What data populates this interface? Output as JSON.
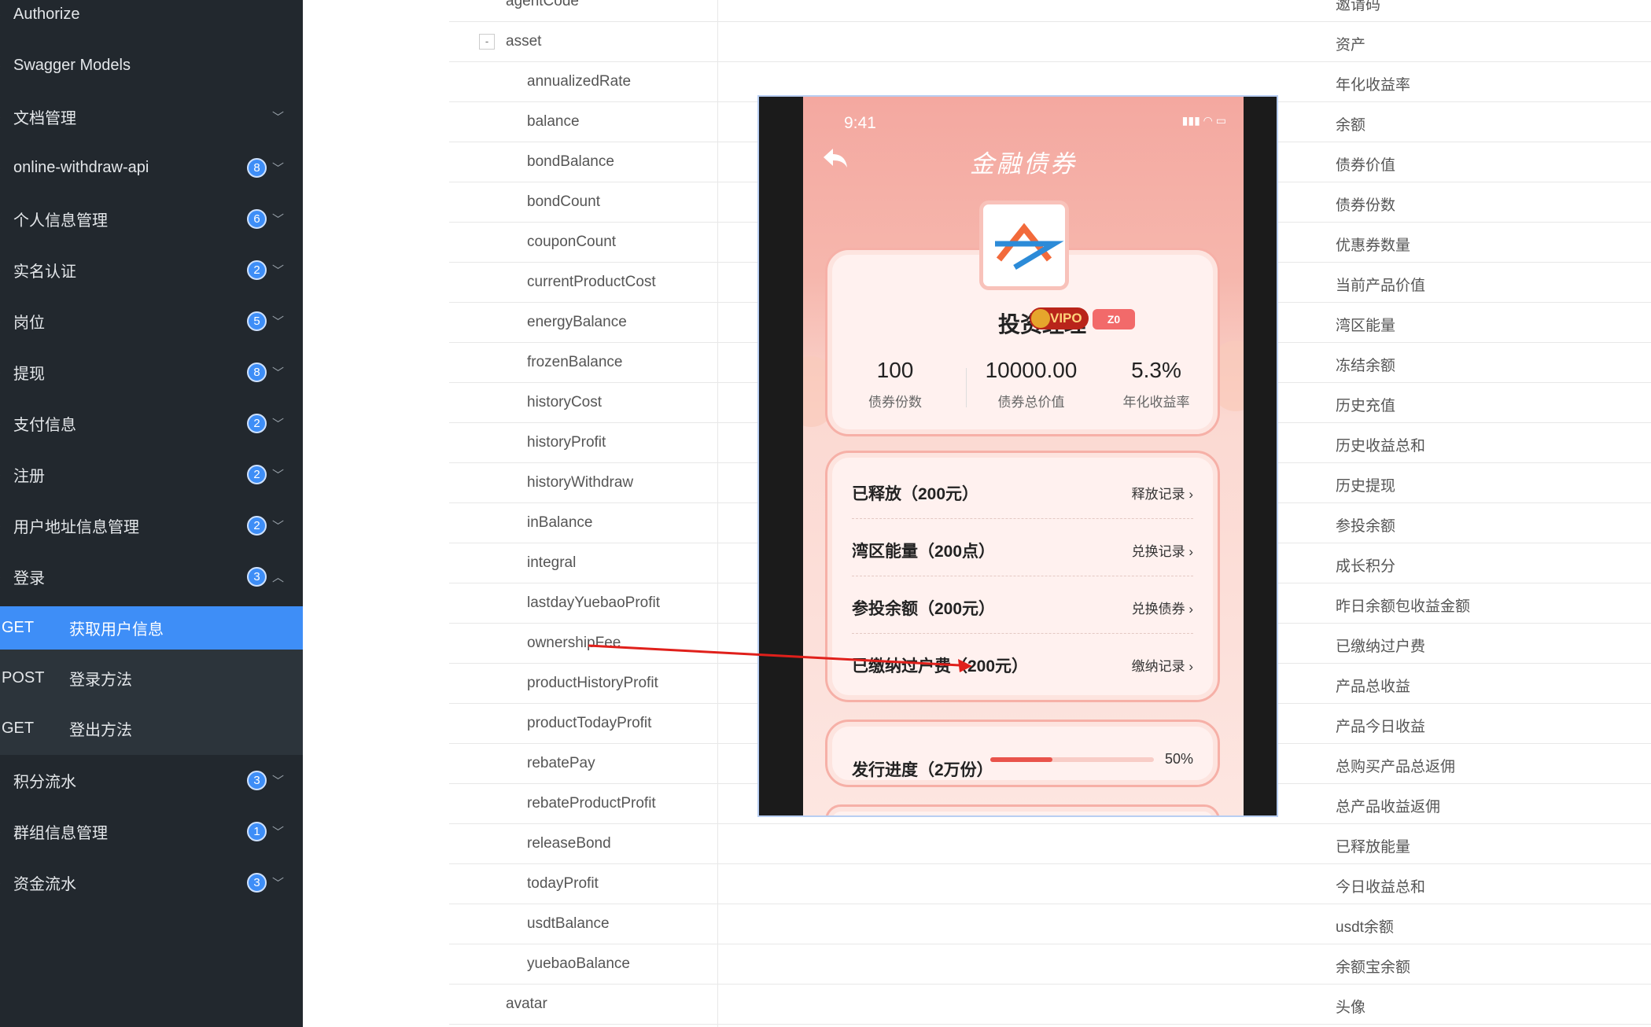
{
  "sidebar": {
    "items": [
      {
        "label": "Authorize",
        "badge": "",
        "expanded": false
      },
      {
        "label": "Swagger Models",
        "badge": "",
        "expanded": false
      },
      {
        "label": "文档管理",
        "badge": "",
        "expanded": false
      },
      {
        "label": "online-withdraw-api",
        "badge": "8",
        "expanded": false
      },
      {
        "label": "个人信息管理",
        "badge": "6",
        "expanded": false
      },
      {
        "label": "实名认证",
        "badge": "2",
        "expanded": false
      },
      {
        "label": "岗位",
        "badge": "5",
        "expanded": false
      },
      {
        "label": "提现",
        "badge": "8",
        "expanded": false
      },
      {
        "label": "支付信息",
        "badge": "2",
        "expanded": false
      },
      {
        "label": "注册",
        "badge": "2",
        "expanded": false
      },
      {
        "label": "用户地址信息管理",
        "badge": "2",
        "expanded": false
      },
      {
        "label": "登录",
        "badge": "3",
        "expanded": true
      },
      {
        "label": "积分流水",
        "badge": "3",
        "expanded": false
      },
      {
        "label": "群组信息管理",
        "badge": "1",
        "expanded": false
      },
      {
        "label": "资金流水",
        "badge": "3",
        "expanded": false
      }
    ],
    "login_subitems": [
      {
        "method": "GET",
        "label": "获取用户信息",
        "active": true
      },
      {
        "method": "POST",
        "label": "登录方法",
        "active": false
      },
      {
        "method": "GET",
        "label": "登出方法",
        "active": false
      }
    ]
  },
  "table": {
    "rows": [
      {
        "name": "agentCode",
        "desc": "邀请码",
        "level": 1
      },
      {
        "name": "asset",
        "desc": "资产",
        "level": 1,
        "toggle": "-"
      },
      {
        "name": "annualizedRate",
        "desc": "年化收益率",
        "level": 2
      },
      {
        "name": "balance",
        "desc": "余额",
        "level": 2
      },
      {
        "name": "bondBalance",
        "desc": "债券价值",
        "level": 2
      },
      {
        "name": "bondCount",
        "desc": "债券份数",
        "level": 2
      },
      {
        "name": "couponCount",
        "desc": "优惠券数量",
        "level": 2
      },
      {
        "name": "currentProductCost",
        "desc": "当前产品价值",
        "level": 2
      },
      {
        "name": "energyBalance",
        "desc": "湾区能量",
        "level": 2
      },
      {
        "name": "frozenBalance",
        "desc": "冻结余额",
        "level": 2
      },
      {
        "name": "historyCost",
        "desc": "历史充值",
        "level": 2
      },
      {
        "name": "historyProfit",
        "desc": "历史收益总和",
        "level": 2
      },
      {
        "name": "historyWithdraw",
        "desc": "历史提现",
        "level": 2
      },
      {
        "name": "inBalance",
        "desc": "参投余额",
        "level": 2
      },
      {
        "name": "integral",
        "desc": "成长积分",
        "level": 2
      },
      {
        "name": "lastdayYuebaoProfit",
        "desc": "昨日余额包收益金额",
        "level": 2
      },
      {
        "name": "ownershipFee",
        "desc": "已缴纳过户费",
        "level": 2
      },
      {
        "name": "productHistoryProfit",
        "desc": "产品总收益",
        "level": 2
      },
      {
        "name": "productTodayProfit",
        "desc": "产品今日收益",
        "level": 2
      },
      {
        "name": "rebatePay",
        "desc": "总购买产品总返佣",
        "level": 2
      },
      {
        "name": "rebateProductProfit",
        "desc": "总产品收益返佣",
        "level": 2
      },
      {
        "name": "releaseBond",
        "desc": "已释放能量",
        "level": 2
      },
      {
        "name": "todayProfit",
        "desc": "今日收益总和",
        "level": 2
      },
      {
        "name": "usdtBalance",
        "desc": "usdt余额",
        "level": 2
      },
      {
        "name": "yuebaoBalance",
        "desc": "余额宝余额",
        "level": 2
      },
      {
        "name": "avatar",
        "desc": "头像",
        "level": 1
      }
    ]
  },
  "phone": {
    "time": "9:41",
    "title": "金融债券",
    "manager_name": "投资经理",
    "vip_label": "VIPO",
    "z_label": "Z0",
    "stats": [
      {
        "value": "100",
        "label": "债券份数"
      },
      {
        "value": "10000.00",
        "label": "债券总价值"
      },
      {
        "value": "5.3%",
        "label": "年化收益率"
      }
    ],
    "lines": [
      {
        "left": "已释放（200元）",
        "right": "释放记录 ›"
      },
      {
        "left": "湾区能量（200点）",
        "right": "兑换记录 ›"
      },
      {
        "left": "参投余额（200元）",
        "right": "兑换债券 ›"
      },
      {
        "left": "已缴纳过户费（200元）",
        "right": "缴纳记录 ›"
      }
    ],
    "progress": {
      "label": "发行进度（2万份）",
      "percent_text": "50%",
      "fraction": 0.38
    }
  },
  "colors": {
    "sidebar_bg": "#22282e",
    "active_blue": "#3e8ef7",
    "annotation_red": "#e0201b"
  }
}
